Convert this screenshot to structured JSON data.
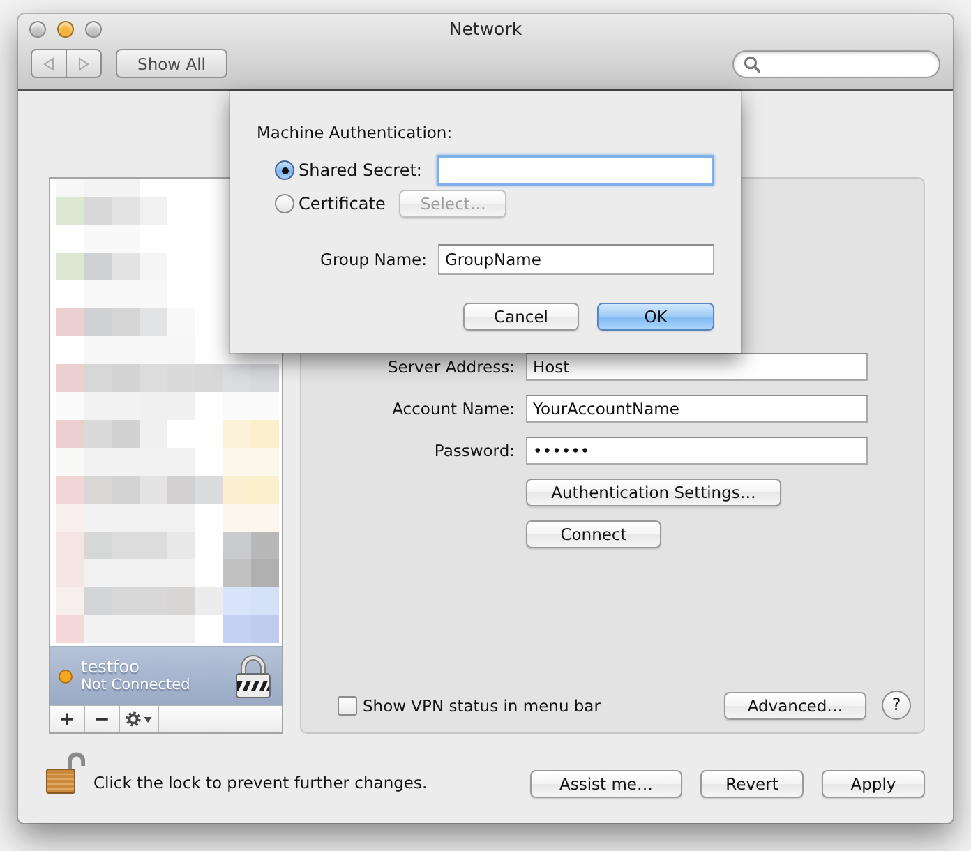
{
  "window": {
    "title": "Network",
    "buttons": [
      {
        "kind": "close",
        "disabled": true
      },
      {
        "kind": "minimize",
        "disabled": false
      },
      {
        "kind": "zoom",
        "disabled": true
      }
    ]
  },
  "toolbar": {
    "nav": [
      {
        "kind": "back",
        "disabled": true
      },
      {
        "kind": "forward",
        "disabled": true
      }
    ],
    "show_all": "Show All"
  },
  "sheet": {
    "title": "Machine Authentication:",
    "options": [
      {
        "kind": "field",
        "label": "Shared Secret:",
        "selected": true,
        "focused": true
      },
      {
        "kind": "button",
        "label": "Certificate",
        "selected": false,
        "button": "Select…",
        "disabled": true
      }
    ],
    "group_name": {
      "label": "Group Name:",
      "value": "GroupName"
    },
    "buttons": [
      {
        "label": "Cancel",
        "default": false
      },
      {
        "label": "OK",
        "default": true
      }
    ]
  },
  "sidebar": {
    "services": [
      {
        "name": "testfoo",
        "status": "Not Connected",
        "color": "#f5a623",
        "selected": true
      }
    ],
    "buttons": [
      {
        "kind": "add",
        "label": "+"
      },
      {
        "kind": "remove",
        "label": "−"
      },
      {
        "kind": "action"
      }
    ]
  },
  "panel": {
    "fields": [
      {
        "label": "Server Address:",
        "value": "Host"
      },
      {
        "label": "Account Name:",
        "value": "YourAccountName"
      },
      {
        "label": "Password:",
        "value": "••••••"
      }
    ],
    "buttons": [
      "Authentication Settings…",
      "Connect"
    ],
    "show_vpn_status": {
      "label": "Show VPN status in menu bar",
      "checked": false
    },
    "advanced": "Advanced…",
    "help": "?"
  },
  "lock": {
    "locked": false,
    "text": "Click the lock to prevent further changes."
  },
  "footer_buttons": [
    "Assist me…",
    "Revert",
    "Apply"
  ]
}
